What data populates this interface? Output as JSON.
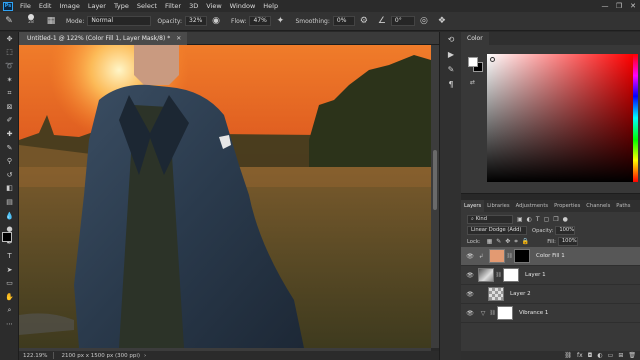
{
  "menu": [
    "File",
    "Edit",
    "Image",
    "Layer",
    "Type",
    "Select",
    "Filter",
    "3D",
    "View",
    "Window",
    "Help"
  ],
  "window_controls": [
    "—",
    "❐",
    "✕"
  ],
  "options": {
    "brush_size": "28",
    "mode_label": "Mode:",
    "mode_value": "Normal",
    "opacity_label": "Opacity:",
    "opacity_value": "32%",
    "flow_label": "Flow:",
    "flow_value": "47%",
    "smoothing_label": "Smoothing:",
    "smoothing_value": "0%",
    "angle_value": "0°"
  },
  "document": {
    "tab_title": "Untitled-1 @ 122% (Color Fill 1, Layer Mask/8) *",
    "zoom": "122.19%",
    "doc_info": "2100 px x 1500 px (300 ppi)"
  },
  "color_panel": {
    "tab": "Color"
  },
  "layers_panel": {
    "tabs": [
      "Layers",
      "Libraries",
      "Adjustments",
      "Properties",
      "Channels",
      "Paths"
    ],
    "filter_kind": "Kind",
    "blend_mode": "Linear Dodge (Add)",
    "opacity_label": "Opacity:",
    "opacity_value": "100%",
    "lock_label": "Lock:",
    "fill_label": "Fill:",
    "fill_value": "100%",
    "layers": [
      {
        "name": "Color Fill 1",
        "selected": true
      },
      {
        "name": "Layer 1"
      },
      {
        "name": "Layer 2"
      },
      {
        "name": "Vibrance 1"
      }
    ]
  },
  "colors": {
    "fill_swatch": "#e39a72",
    "accent": "#2fa3f5"
  }
}
